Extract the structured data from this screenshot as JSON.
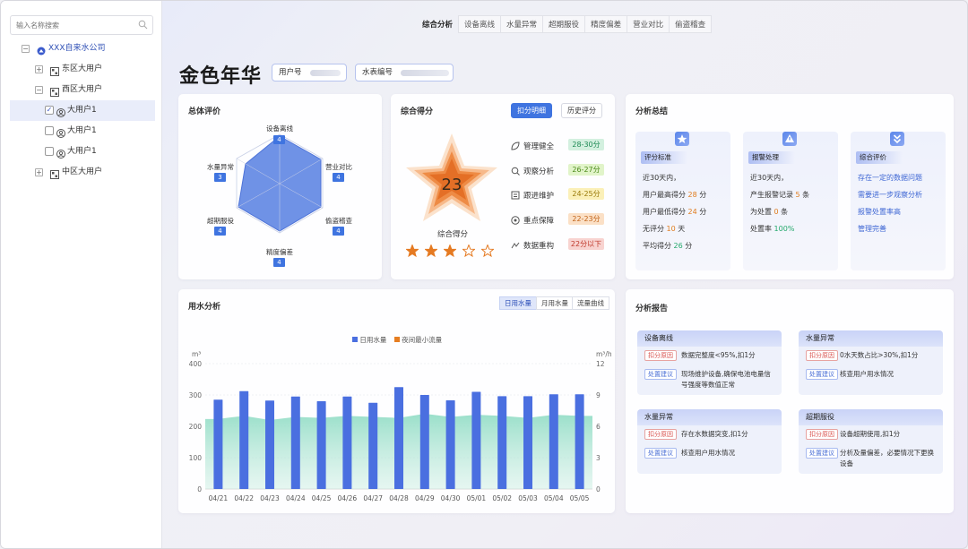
{
  "sidebar": {
    "search_placeholder": "输入名称搜索",
    "tree": [
      {
        "label": "XXX自来水公司",
        "expander": "−"
      },
      {
        "label": "东区大用户",
        "expander": "+"
      },
      {
        "label": "西区大用户",
        "expander": "−"
      },
      {
        "label": "大用户1",
        "checked": true,
        "check_mark": "✓"
      },
      {
        "label": "大用户1",
        "checked": false
      },
      {
        "label": "大用户1",
        "checked": false
      },
      {
        "label": "中区大用户",
        "expander": "+"
      }
    ]
  },
  "tabs": [
    "综合分析",
    "设备离线",
    "水量异常",
    "超期服役",
    "精度偏差",
    "营业对比",
    "偷盗稽查"
  ],
  "header": {
    "title": "金色年华",
    "user_no_label": "用户号",
    "meter_no_label": "水表编号"
  },
  "overall": {
    "title": "总体评价",
    "vertices": [
      {
        "label": "设备离线",
        "value": "4"
      },
      {
        "label": "营业对比",
        "value": "4"
      },
      {
        "label": "偷盗稽查",
        "value": "4"
      },
      {
        "label": "精度偏差",
        "value": "4"
      },
      {
        "label": "超期服役",
        "value": "4"
      },
      {
        "label": "水量异常",
        "value": "3"
      }
    ]
  },
  "score": {
    "title": "综合得分",
    "btn_detail": "扣分明细",
    "btn_history": "历史评分",
    "value": "23",
    "caption": "综合得分",
    "stars_filled": 3,
    "stars_total": 5,
    "levels": [
      {
        "label": "管理健全",
        "range": "28-30分",
        "bg": "#d3f0df",
        "fg": "#1f8a55"
      },
      {
        "label": "观察分析",
        "range": "26-27分",
        "bg": "#e1f4c9",
        "fg": "#4c8a1a"
      },
      {
        "label": "跟进维护",
        "range": "24-25分",
        "bg": "#fbf0b8",
        "fg": "#9a7a0a"
      },
      {
        "label": "重点保障",
        "range": "22-23分",
        "bg": "#fbe0c6",
        "fg": "#c2651b"
      },
      {
        "label": "数据重构",
        "range": "22分以下",
        "bg": "#f8d3d0",
        "fg": "#c0392b"
      }
    ]
  },
  "summary": {
    "title": "分析总结",
    "cards": [
      {
        "header": "评分标准",
        "lines": [
          {
            "text": "近30天内，",
            "hl": "",
            "tail": ""
          },
          {
            "text": "用户最高得分 ",
            "hl": "28",
            "tail": " 分",
            "hl_class": "hl-o"
          },
          {
            "text": "用户最低得分 ",
            "hl": "24",
            "tail": " 分",
            "hl_class": "hl-o"
          },
          {
            "text": "无评分 ",
            "hl": "10",
            "tail": " 天",
            "hl_class": "hl-o"
          },
          {
            "text": "平均得分 ",
            "hl": "26",
            "tail": " 分",
            "hl_class": "hl-g"
          }
        ]
      },
      {
        "header": "报警处理",
        "lines": [
          {
            "text": "近30天内，",
            "hl": "",
            "tail": ""
          },
          {
            "text": "产生报警记录 ",
            "hl": "5",
            "tail": " 条",
            "hl_class": "hl-o"
          },
          {
            "text": "为处置 ",
            "hl": "0",
            "tail": " 条",
            "hl_class": "hl-o"
          },
          {
            "text": "处置率 ",
            "hl": "100%",
            "tail": "",
            "hl_class": "hl-g"
          }
        ]
      },
      {
        "header": "综合评价",
        "lines": [
          {
            "text": "存在一定的数据问题",
            "hl": "",
            "tail": ""
          },
          {
            "text": "需要进一步观察分析",
            "hl": "",
            "tail": ""
          },
          {
            "text": "报警处置率高",
            "hl": "",
            "tail": ""
          },
          {
            "text": "管理完善",
            "hl": "",
            "tail": ""
          }
        ]
      }
    ]
  },
  "usage": {
    "title": "用水分析",
    "segments": [
      "日用水量",
      "月用水量",
      "流量曲线"
    ],
    "active_segment": 0,
    "legend": [
      "日用水量",
      "夜间最小流量"
    ],
    "left_unit": "m³",
    "right_unit": "m³/h"
  },
  "chart_data": {
    "type": "bar",
    "categories": [
      "04/21",
      "04/22",
      "04/23",
      "04/24",
      "04/25",
      "04/26",
      "04/27",
      "04/28",
      "04/29",
      "04/30",
      "05/01",
      "05/02",
      "05/03",
      "05/04",
      "05/05"
    ],
    "series": [
      {
        "name": "日用水量",
        "type": "bar",
        "axis": "left",
        "color": "#4a6fe0",
        "values": [
          285,
          312,
          282,
          295,
          280,
          295,
          275,
          325,
          300,
          283,
          310,
          296,
          296,
          302,
          302
        ]
      },
      {
        "name": "夜间最小流量",
        "type": "area",
        "axis": "right",
        "color": "#8fdcc4",
        "values": [
          6.7,
          7.0,
          6.6,
          6.9,
          6.8,
          7.0,
          6.9,
          6.8,
          7.2,
          6.9,
          7.1,
          7.0,
          6.8,
          7.1,
          7.0
        ]
      }
    ],
    "ylim": [
      0,
      400
    ],
    "yticks": [
      0,
      100,
      200,
      300,
      400
    ],
    "y2lim": [
      0,
      12
    ],
    "y2ticks": [
      0,
      3,
      6,
      9,
      12
    ],
    "legend_position": "top"
  },
  "report": {
    "title": "分析报告",
    "items": [
      {
        "header": "设备离线",
        "reason_tag": "扣分原因",
        "reason": "数据完整度<95%,扣1分",
        "advice_tag": "处置建议",
        "advice": "现场维护设备,确保电池电量信号强度等数值正常"
      },
      {
        "header": "水量异常",
        "reason_tag": "扣分原因",
        "reason": "0水天数占比>30%,扣1分",
        "advice_tag": "处置建议",
        "advice": "核查用户用水情况"
      },
      {
        "header": "水量异常",
        "reason_tag": "扣分原因",
        "reason": "存在水数据突变,扣1分",
        "advice_tag": "处置建议",
        "advice": "核查用户用水情况"
      },
      {
        "header": "超期服役",
        "reason_tag": "扣分原因",
        "reason": "设备超期使用,扣1分",
        "advice_tag": "处置建议",
        "advice": "分析及量偏差，必要情况下更换设备"
      }
    ]
  }
}
